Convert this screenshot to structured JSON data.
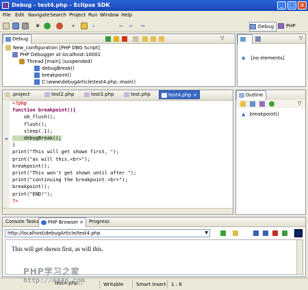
{
  "window": {
    "title": "Debug - test4.php - Eclipse SDK"
  },
  "menu": [
    "File",
    "Edit",
    "Navigate",
    "Search",
    "Project",
    "Run",
    "Window",
    "Help"
  ],
  "perspectives": {
    "debug": "Debug",
    "php": "PHP"
  },
  "debug_view": {
    "tab": "Debug",
    "tree": [
      "New_configuration [PHP DBG Script]",
      "PHP Debugger at localhost:10001",
      "Thread [main] (suspended)",
      "debugBreak()",
      "breakpoint()",
      "C:\\www\\debugArticle\\test4.php::main()"
    ]
  },
  "variables_view": {
    "item": "[no elements]"
  },
  "editor": {
    "tabs": [
      ".project",
      "test2.php",
      "test3.php",
      "test.php",
      "test4.php"
    ],
    "active_tab": "test4.php",
    "lines": [
      "<?php",
      "function breakpoint(){",
      "    ob_flush();",
      "    flush();",
      "    sleep(.1);",
      "    debugBreak();",
      "}",
      "print(\"This will get shown first, \");",
      "print(\"as will this.<br>\");",
      "breakpoint();",
      "print(\"This won't get shown until after \");",
      "print(\"continuing the breakpoint.<br>\");",
      "breakpoint();",
      "print(\"END!\");",
      "?>"
    ]
  },
  "outline_view": {
    "tab": "Outline",
    "item": "breakpoint()"
  },
  "bottom_tabs": [
    "Console",
    "Tasks",
    "PHP Browser",
    "Progress"
  ],
  "browser": {
    "url": "http://localhost/debugArticle/test4.php",
    "content": "This will get shown first, as will this."
  },
  "status": {
    "message": "test4.php...",
    "mode": "Writable",
    "insert": "Smart Insert",
    "position": "1 : 6"
  },
  "watermark": {
    "line1": "PHP学习之家",
    "line2": "http://444p.com"
  }
}
